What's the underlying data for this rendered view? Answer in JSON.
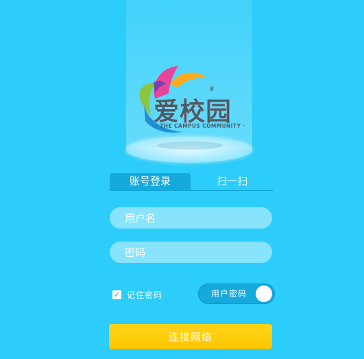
{
  "brand": {
    "title": "爱校园",
    "subtitle": "· THE CAMPUS COMMUNITY ·",
    "crown": "♛"
  },
  "tabs": [
    {
      "label": "账号登录",
      "active": true
    },
    {
      "label": "扫一扫",
      "active": false
    }
  ],
  "form": {
    "username_placeholder": "用户名",
    "password_placeholder": "密码",
    "username_value": "",
    "password_value": ""
  },
  "remember": {
    "label": "记住密码",
    "checked": true,
    "check_glyph": "✓"
  },
  "mode_toggle": {
    "label": "用户密码",
    "on": true
  },
  "connect_button": {
    "label": "连接网络"
  },
  "colors": {
    "background": "#2ccdfa",
    "tab_active": "#16a9dc",
    "input_fill": "#88e3fd",
    "button_yellow": "#ffc700",
    "logo_text": "#4d5a66"
  }
}
